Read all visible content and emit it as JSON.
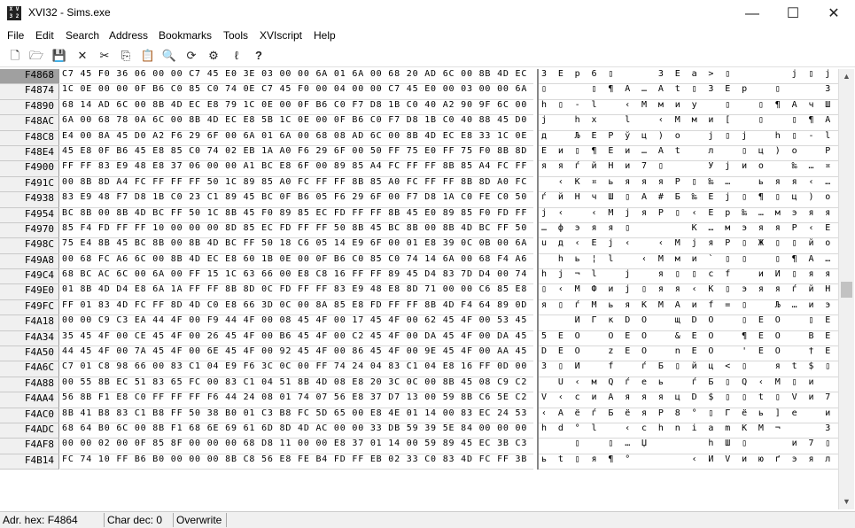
{
  "window": {
    "title": "XVI32 - Sims.exe",
    "min": "—",
    "max": "☐",
    "close": "✕",
    "app_icon": "xvi-icon"
  },
  "menu": [
    "File",
    "Edit",
    "Search",
    "Address",
    "Bookmarks",
    "Tools",
    "XVIscript",
    "Help"
  ],
  "toolbar_icons": [
    "new-file-icon",
    "open-folder-icon",
    "save-disk-icon",
    "close-x-icon",
    "cut-scissors-icon",
    "copy-icon",
    "paste-icon",
    "find-icon",
    "find-next-icon",
    "properties-icon",
    "script-icon",
    "help-cursor-icon"
  ],
  "toolbar_glyphs": [
    "🗋",
    "🗁",
    "💾",
    "✕",
    "✂",
    "⎘",
    "📋",
    "🔍",
    "⟳",
    "⚙",
    "ℓ",
    "?"
  ],
  "rows": [
    {
      "addr": "F4868",
      "hex": "C7 45 F0 36 06 00 00 C7 45 E0 3E 03 00 00 6A 01 6A 00 68 20 AD 6C 00 8B 4D EC E8 9F",
      "txt": "З Е р 6 ▯     З Е а > ▯       j ▯ j   h   - l   ‹ M м и ц"
    },
    {
      "addr": "F4874",
      "hex": "1C 0E 00 00 0F B6 C0 85 C0 74 0E C7 45 F0 00 04 00 00 C7 45 E0 00 03 00 00 6A 01 6A 00",
      "txt": "▯     ▯ ¶ А … А t ▯ З Е р   ▯     З Е а   ▯     j ▯ j"
    },
    {
      "addr": "F4890",
      "hex": "68 14 AD 6C 00 8B 4D EC E8 79 1C 0E 00 0F B6 C0 F7 D8 1B C0 40 A2 90 9F 6C 00 6A 01",
      "txt": "h ▯ - l   ‹ M м и у   ▯   ▯ ¶ А ч Ш ▯ А @ ў ђ џ l   j ▯"
    },
    {
      "addr": "F48AC",
      "hex": "6A 00 68 78 0A 6C 00 8B 4D EC E8 5B 1C 0E 00 0F B6 C0 F7 D8 1B C0 40 88 45 D0 80 65",
      "txt": "j   h x   l   ‹ M м и [   ▯   ▯ ¶ А ч Ш ▯ А @ € Е Р Ђ е"
    },
    {
      "addr": "F48C8",
      "hex": "E4 00 8A 45 D0 A2 F6 29 6F 00 6A 01 6A 00 68 08 AD 6C 00 8B 4D EC E8 33 1C 0E 00 88",
      "txt": "д   Љ Е Р ў ц ) o   j ▯ j   h ▯ - l   ‹ M м и 3   ▯   €"
    },
    {
      "addr": "F48E4",
      "hex": "45 E8 0F B6 45 E8 85 C0 74 02 EB 1A A0 F6 29 6F 00 50 FF 75 E0 FF 75 F0 8B 8D 0C FD",
      "txt": "Е и ▯ ¶ Е и … А t   л   ▯ ц ) o   Р я u а я u р ‹ Ќ ▯ э"
    },
    {
      "addr": "F4900",
      "hex": "FF FF 83 E9 48 E8 37 06 00 00 A1 BC E8 6F 00 89 85 A4 FC FF FF 8B 85 A4 FC FF FF 8B",
      "txt": "я я ѓ й Н и 7 ▯     Ў ј и о   ‰ … ¤ ь я я ‹ … ¤ ь я я ‹"
    },
    {
      "addr": "F491C",
      "hex": "00 8B 8D A4 FC FF FF FF 50 1C 89 85 A0 FC FF FF 8B 85 A0 FC FF FF 8B 8D A0 FC FF FF",
      "txt": "  ‹ Ќ ¤ ь я я я Р ▯ ‰ …   ь я я ‹ …   ь я я ‹ Ќ   ь я я"
    },
    {
      "addr": "F4938",
      "hex": "83 E9 48 F7 D8 1B C0 23 C1 89 45 BC 0F B6 05 F6 29 6F 00 F7 D8 1A C0 FE C0 50 8B 45",
      "txt": "ѓ й Н ч Ш ▯ А # Б ‰ Е ј ▯ ¶ ▯ ц ) o   ч Ш ▯ А ю А Р ‹ Е"
    },
    {
      "addr": "F4954",
      "hex": "BC 8B 00 8B 4D BC FF 50 1C 8B 45 F0 89 85 EC FD FF FF 8B 45 E0 89 85 F0 FD FF FF C7",
      "txt": "ј ‹   ‹ M ј я Р ▯ ‹ Е р ‰ … м э я я ‹ Е а ‰ … р э я я З"
    },
    {
      "addr": "F4970",
      "hex": "85 F4 FD FF FF 10 00 00 00 8D 85 EC FD FF FF 50 8B 45 BC 8B 00 8B 4D BC FF 50 14 FF",
      "txt": "… ф э я я ▯       Ќ … м э я я Р ‹ Е ј ‹   ‹ M ј я Р ▯ я"
    },
    {
      "addr": "F498C",
      "hex": "75 E4 8B 45 BC 8B 00 8B 4D BC FF 50 18 C6 05 14 E9 6F 00 01 E8 39 0C 0B 00 6A 01 6A",
      "txt": "u д ‹ Е ј ‹   ‹ M ј я Р ▯ Ж ▯ ▯ й o   ▯ и 9 ▯ ▯   j ▯ j"
    },
    {
      "addr": "F49A8",
      "hex": "00 68 FC A6 6C 00 8B 4D EC E8 60 1B 0E 00 0F B6 C0 85 C0 74 14 6A 00 68 F4 A6 6C 00",
      "txt": "  h ь ¦ l   ‹ M м и ` ▯ ▯   ▯ ¶ А … А t ▯ j   h ф ¦ l"
    },
    {
      "addr": "F49C4",
      "hex": "68 BC AC 6C 00 6A 00 FF 15 1C 63 66 00 E8 C8 16 FF FF 89 45 D4 83 7D D4 00 74 0A 6A",
      "txt": "h ј ¬ l   j   я ▯ ▯ c f   и И ▯ я я ‰ Е Ф ѓ } Ф   t   j"
    },
    {
      "addr": "F49E0",
      "hex": "01 8B 4D D4 E8 6A 1A FF FF 8B 8D 0C FD FF FF 83 E9 48 E8 8D 71 00 00 C6 85 E8 FD FF",
      "txt": "▯ ‹ M Ф и j ▯ я я ‹ Ќ ▯ э я я ѓ й Н и Ќ q     Ж … и э я"
    },
    {
      "addr": "F49FC",
      "hex": "FF 01 83 4D FC FF 8D 4D C0 E8 66 3D 0C 00 8A 85 E8 FD FF FF 8B 4D F4 64 89 0D 00 00",
      "txt": "я ▯ ѓ M ь я Ќ M А и f = ▯   Љ … и э я я ‹ M ф d ‰ ▯"
    },
    {
      "addr": "F4A18",
      "hex": "00 00 C9 C3 EA 44 4F 00 F9 44 4F 00 08 45 4F 00 17 45 4F 00 62 45 4F 00 53 45 4F 00",
      "txt": "    Й Г к D O   щ D O   ▯ E O   ▯ E O   b E O   S E O"
    },
    {
      "addr": "F4A34",
      "hex": "35 45 4F 00 CE 45 4F 00 26 45 4F 00 B6 45 4F 00 C2 45 4F 00 DA 45 4F 00 DA 45 4F 00",
      "txt": "5 E O   О E O   & E O   ¶ E O   В E O   Ъ E O   Ъ E O"
    },
    {
      "addr": "F4A50",
      "hex": "44 45 4F 00 7A 45 4F 00 6E 45 4F 00 92 45 4F 00 86 45 4F 00 9E 45 4F 00 AA 45 4F 00",
      "txt": "D E O   z E O   n E O   ' E O   † E O   ћ E O   Є E O"
    },
    {
      "addr": "F4A6C",
      "hex": "C7 01 C8 98 66 00 83 C1 04 E9 F6 3C 0C 00 FF 74 24 04 83 C1 04 E8 16 FF 0D 00 C2 04",
      "txt": "З ▯ И   f   ѓ Б ▯ й ц < ▯   я t $ ▯ ѓ Б ▯ и ▯ я ▯   В ▯"
    },
    {
      "addr": "F4A88",
      "hex": "00 55 8B EC 51 83 65 FC 00 83 C1 04 51 8B 4D 08 E8 20 3C 0C 00 8B 45 08 C9 C2 04 00",
      "txt": "  U ‹ м Q ѓ е ь   ѓ Б ▯ Q ‹ M ▯ и   < ▯   ‹ Е ▯ Й В ▯"
    },
    {
      "addr": "F4AA4",
      "hex": "56 8B F1 E8 C0 FF FF FF F6 44 24 08 01 74 07 56 E8 37 D7 13 00 59 8B C6 5E C2 04 00",
      "txt": "V ‹ с и А я я я ц D $ ▯ ▯ t ▯ V и 7 Ч ▯   Y ‹ Ж ^ В ▯"
    },
    {
      "addr": "F4AC0",
      "hex": "8B 41 B8 83 C1 B8 FF 50 38 B0 01 C3 B8 FC 5D 65 00 E8 4E 01 14 00 83 EC 24 53 56 57",
      "txt": "‹ A ё ѓ Б ё я Р 8 ° ▯ Г ё ь ] е   и N ▯ ▯   ѓ м $ S V W"
    },
    {
      "addr": "F4ADC",
      "hex": "68 64 B0 6C 00 8B F1 68 6E 69 61 6D 8D 4D AC 00 00 33 DB 59 39 5E 84 00 00 00 59 BF",
      "txt": "h d ° l   ‹ с h n i a m Ќ M ¬     3 Ы Y 9 ^ „       Y ї"
    },
    {
      "addr": "F4AF8",
      "hex": "00 00 02 00 0F 85 8F 00 00 00 68 D8 11 00 00 E8 37 01 14 00 59 89 45 EC 3B C3 89 5D",
      "txt": "    ▯   ▯ … Џ       h Ш ▯     и 7 ▯ ▯   Y ‰ Е м ; Г ‰ ]"
    },
    {
      "addr": "F4B14",
      "hex": "FC 74 10 FF B6 B0 00 00 00 8B C8 56 E8 FE B4 FD FF EB 02 33 C0 83 4D FC FF 3B C3 89",
      "txt": "ь t ▯ я ¶ °       ‹ И V и ю ґ э я л ▯ 3 А ѓ M ь я ; Г ‰"
    }
  ],
  "status": {
    "addr": "Adr. hex: F4864",
    "char": "Char dec: 0",
    "mode": "Overwrite"
  }
}
